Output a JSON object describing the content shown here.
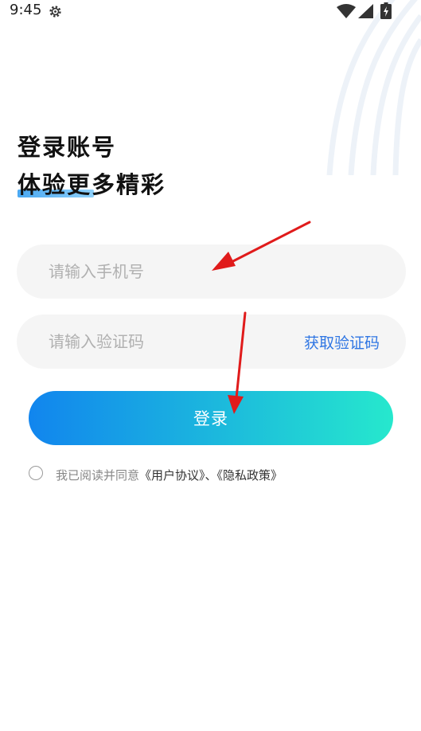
{
  "status_bar": {
    "time": "9:45",
    "icons": [
      "gear-icon",
      "wifi-icon",
      "signal-icon",
      "battery-charging-icon"
    ]
  },
  "header": {
    "title_line1": "登录账号",
    "title_line2": "体验更多精彩"
  },
  "form": {
    "phone_placeholder": "请输入手机号",
    "code_placeholder": "请输入验证码",
    "get_code_label": "获取验证码",
    "login_label": "登录"
  },
  "agreement": {
    "prefix": "我已阅读并同意",
    "user_agreement": "《用户协议》",
    "separator": "、",
    "privacy_policy": "《隐私政策》",
    "checked": false
  },
  "colors": {
    "link_blue": "#2f76e3",
    "button_gradient_start": "#1185ee",
    "button_gradient_end": "#26e8cd",
    "annotation_arrow": "#e01b1b",
    "field_background": "#f5f5f5"
  }
}
